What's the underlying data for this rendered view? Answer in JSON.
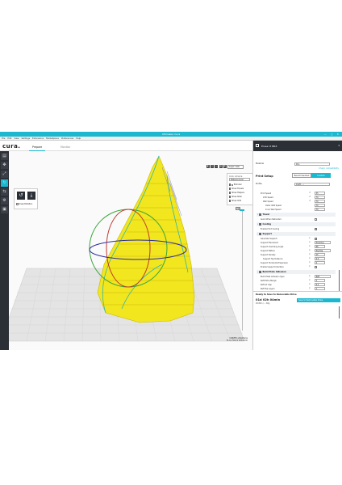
{
  "window": {
    "title": "Ultimaker Cura",
    "controls": "—  ▢  ✕"
  },
  "menubar": [
    "File",
    "Edit",
    "View",
    "Settings",
    "Extensions",
    "Marketplace",
    "Preferences",
    "Help"
  ],
  "header": {
    "logo": "cura.",
    "tabs": [
      {
        "label": "Prepare",
        "active": true
      },
      {
        "label": "Monitor",
        "active": false
      }
    ]
  },
  "rotate_tool": {
    "snap_label": "Snap Rotation"
  },
  "view_toolbar": {
    "view_dropdown": "Layer view"
  },
  "color_scheme": {
    "label": "Color scheme",
    "value": "Material Color",
    "items": [
      {
        "label": "Extruder",
        "color": "#e8e63a"
      },
      {
        "label": "Show Travels",
        "color": "#2a6cc4"
      },
      {
        "label": "Show Helpers",
        "color": "#36c4c4"
      },
      {
        "label": "Show Shell",
        "color": "#e84a2a"
      },
      {
        "label": "Show Infill",
        "color": "#e8a020"
      }
    ]
  },
  "layer": {
    "current": "751"
  },
  "object_info": {
    "name": "CURVED_sholeframe",
    "size": "71.4 x 55.6 x 133.6 mm"
  },
  "printer": {
    "name": "Prusa i3 MK3",
    "dropdown": "▾"
  },
  "material": {
    "label": "Material",
    "value": "PLA",
    "link": "Check compatibility"
  },
  "print_setup": {
    "title": "Print Setup",
    "modes": [
      {
        "label": "Recommended",
        "active": false
      },
      {
        "label": "Custom",
        "active": true
      }
    ],
    "profile_label": "Profile",
    "profile_value": "Draft - ..."
  },
  "settings": {
    "speed_rows": [
      {
        "label": "Print Speed",
        "value": "55",
        "unit": "mm/s"
      },
      {
        "label": "Infill Speed",
        "value": "70",
        "unit": "mm/s"
      },
      {
        "label": "Wall Speed",
        "value": "70",
        "unit": "mm/s"
      },
      {
        "label": "Outer Wall Speed",
        "value": "70",
        "unit": "mm/s"
      },
      {
        "label": "Inner Wall Speed",
        "value": "70",
        "unit": "mm/s"
      }
    ],
    "travel_category": "Travel",
    "travel_rows": [
      {
        "label": "Avoid When Retracted",
        "checked": false
      }
    ],
    "cooling_category": "Cooling",
    "cooling_rows": [
      {
        "label": "Enable Print Cooling",
        "checked": true
      }
    ],
    "support_category": "Support",
    "support_rows": [
      {
        "label": "Generate Support",
        "value": "✓",
        "type": "check"
      },
      {
        "label": "Support Placement",
        "value": "Touching Build...",
        "type": "field"
      },
      {
        "label": "Support Overhang Angle",
        "value": "66",
        "type": "field"
      },
      {
        "label": "Support Pattern",
        "value": "Zig Zag",
        "type": "field"
      },
      {
        "label": "Support Density",
        "value": "15",
        "type": "field"
      },
      {
        "label": "Support Top Distance",
        "value": "0.2",
        "type": "field"
      },
      {
        "label": "Support Horizontal Expansion",
        "value": "0",
        "type": "field"
      },
      {
        "label": "Enable Support Interface",
        "value": "",
        "type": "check"
      }
    ],
    "adhesion_category": "Build Plate Adhesion",
    "adhesion_rows": [
      {
        "label": "Build Plate Adhesion Type",
        "value": "Raft"
      },
      {
        "label": "Raft Extra Margin",
        "value": "3"
      },
      {
        "label": "Raft Air Gap",
        "value": "0.2"
      },
      {
        "label": "Raft Top Layers",
        "value": "1"
      }
    ]
  },
  "footer": {
    "ready": "Ready to Save to Removable Drive",
    "time": "01d 02h 04min",
    "material": "28.86m / ~ 86g",
    "save_button": "Save to Removable Drive"
  }
}
